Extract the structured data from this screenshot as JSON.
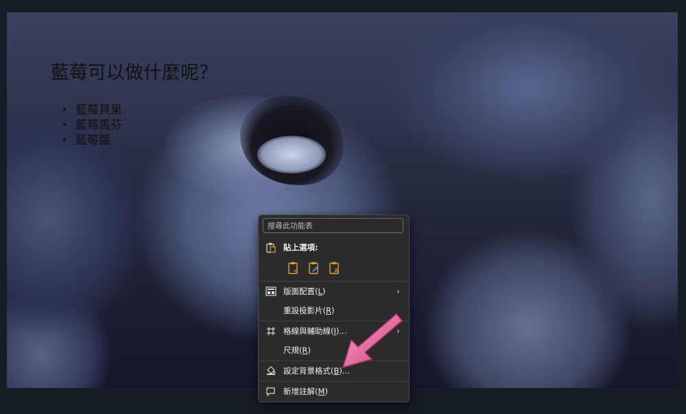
{
  "slide": {
    "title": "藍莓可以做什麼呢？",
    "bullets": [
      "藍莓貝果",
      "藍莓馬芬",
      "藍莓醬"
    ],
    "bullet_glyph": "•"
  },
  "context_menu": {
    "search_placeholder": "搜尋此功能表",
    "paste_header": "貼上選項:",
    "items": [
      {
        "label": "版面配置(",
        "key": "L",
        "tail": ")",
        "submenu": true
      },
      {
        "label": "重設投影片(",
        "key": "R",
        "tail": ")",
        "submenu": false
      },
      {
        "label": "格線與輔助線(",
        "key": "I",
        "tail": ")...",
        "submenu": true
      },
      {
        "label": "尺規(",
        "key": "R",
        "tail": ")",
        "submenu": false
      },
      {
        "label": "設定背景格式(",
        "key": "B",
        "tail": ")...",
        "submenu": false
      },
      {
        "label": "新增註解(",
        "key": "M",
        "tail": ")",
        "submenu": false
      }
    ],
    "submenu_glyph": "›"
  },
  "colors": {
    "menu_bg": "#2b2b2b",
    "accent_orange": "#e8a03c",
    "arrow_pink": "#d8407e"
  }
}
